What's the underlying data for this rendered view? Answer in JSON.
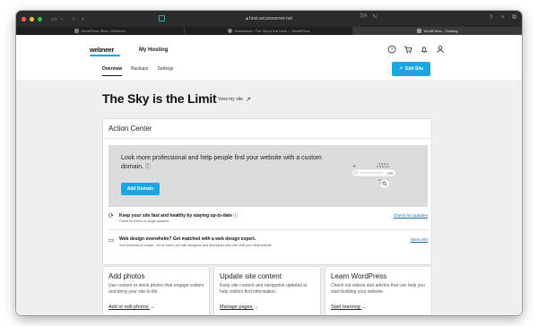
{
  "browser": {
    "url": "host.secureserver.net",
    "tabs": [
      {
        "label": "WordPress Sites | Webneer",
        "active": false
      },
      {
        "label": "Dashboard ‹ The Sky is the Limit — WordPress",
        "active": false
      },
      {
        "label": "WordPress – Hosting",
        "active": true
      }
    ],
    "traffic_lights": [
      "#ff5f57",
      "#febc2e",
      "#28c840"
    ]
  },
  "header": {
    "logo": "webneer",
    "section": "My Hosting",
    "icons": [
      "help-icon",
      "cart-icon",
      "bell-icon",
      "user-icon"
    ]
  },
  "subnav": {
    "items": [
      "Overview",
      "Backups",
      "Settings"
    ],
    "active": "Overview"
  },
  "edit_site_button": "Edit Site",
  "site": {
    "title": "The Sky is the Limit",
    "view_link": "View my site"
  },
  "action_center": {
    "title": "Action Center",
    "banner_text": "Look more professional and help people find your website with a custom domain.",
    "add_domain_button": "Add Domain",
    "illustration_text": ".com",
    "rows": [
      {
        "title": "Keep your site fast and healthy by staying up-to-date",
        "subtitle": "Check for theme or plugin updates",
        "link": "Check for Updates"
      },
      {
        "title": "Web design overwhelm? Get matched with a web design expert.",
        "subtitle": "Your business is unique – let us match you with designers and developers who can craft your ideal website.",
        "link": "More info"
      }
    ]
  },
  "cards": [
    {
      "title": "Add photos",
      "desc": "Use custom or stock photos that engage visitors and bring your site to life.",
      "link": "Add or edit photos"
    },
    {
      "title": "Update site content",
      "desc": "Keep site content and navigation updated to help visitors find information.",
      "link": "Manage pages"
    },
    {
      "title": "Learn WordPress",
      "desc": "Check out videos and articles that can help you start building your website.",
      "link": "Start learning"
    }
  ],
  "colors": {
    "accent": "#1ba7e1",
    "link": "#1b6ea8",
    "page_bg": "#f0f0f1"
  }
}
